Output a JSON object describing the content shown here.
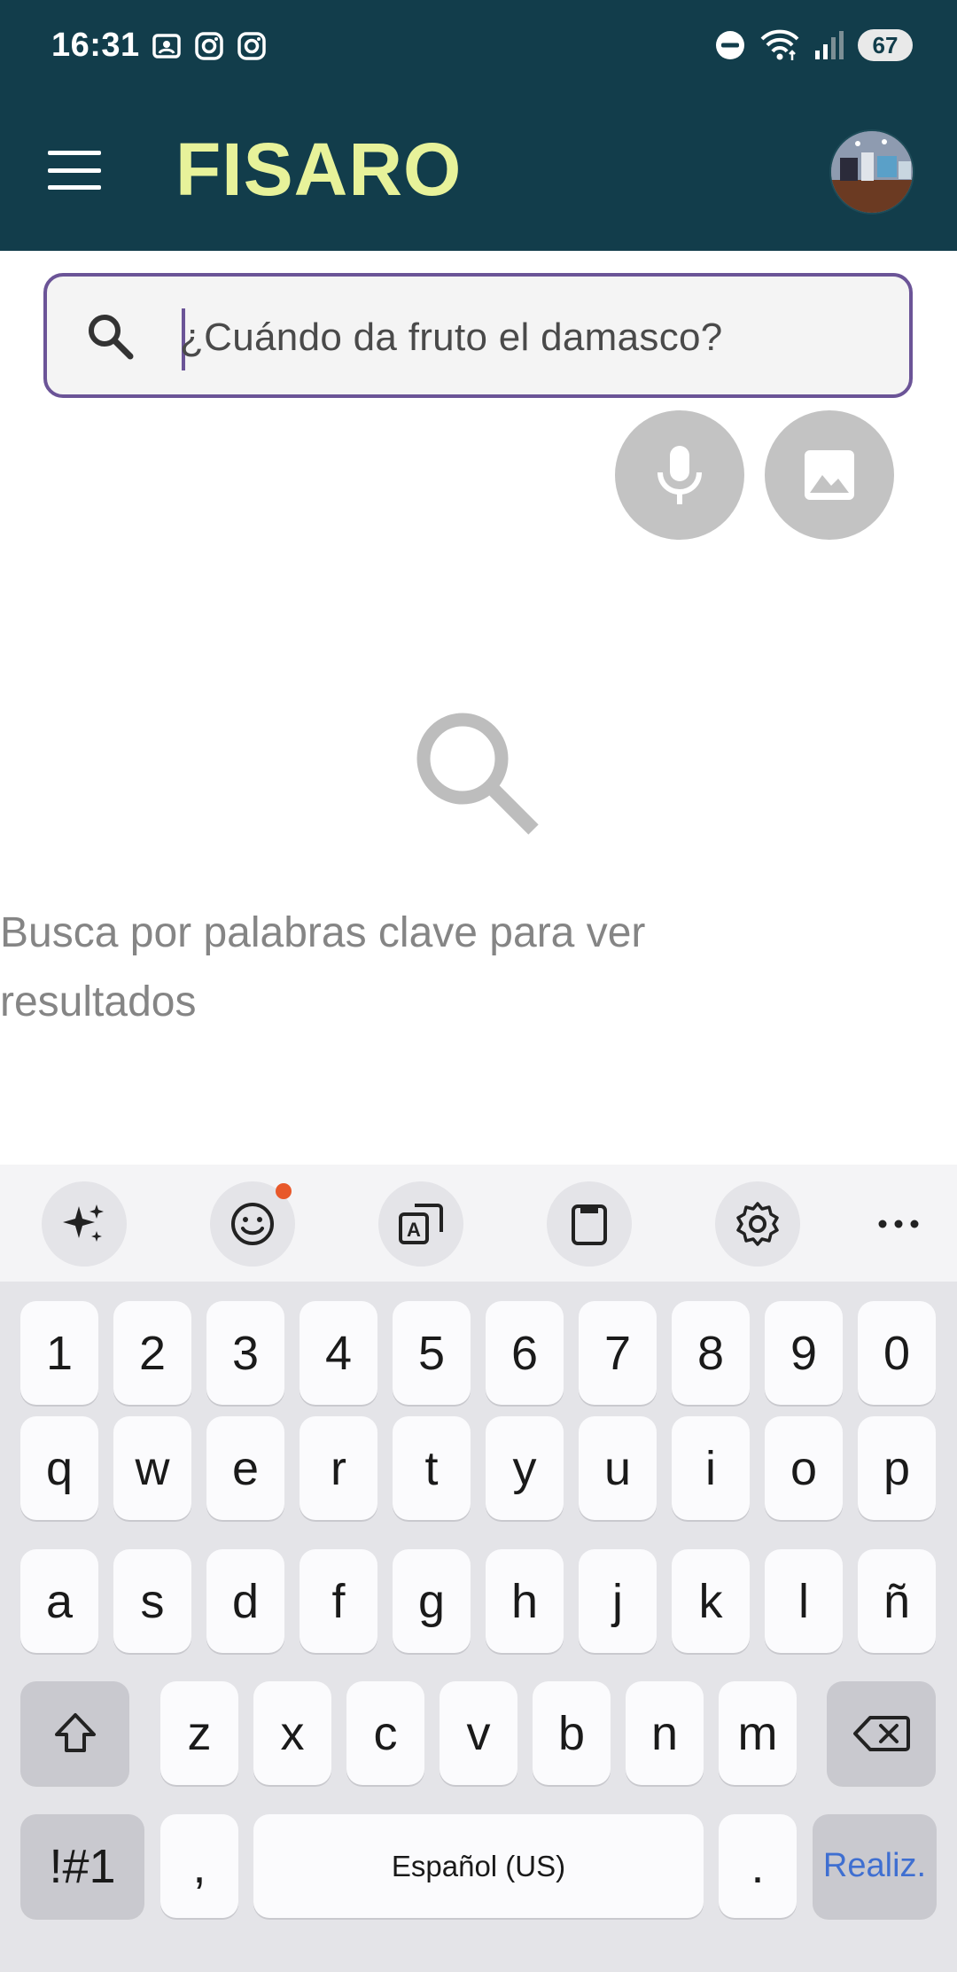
{
  "status_bar": {
    "time": "16:31",
    "battery": "67",
    "left_icons": [
      "screenshot-icon",
      "instagram-icon",
      "instagram-icon"
    ],
    "right_icons": [
      "do-not-disturb-icon",
      "wifi-icon",
      "signal-icon"
    ]
  },
  "header": {
    "brand": "FISARO",
    "brand_color": "#e7f29a",
    "background_color": "#123d4b"
  },
  "search": {
    "placeholder": "¿Cuándo da fruto el damasco?",
    "value": "",
    "border_color": "#6b5497"
  },
  "actions": {
    "voice_icon": "microphone-icon",
    "image_icon": "image-icon"
  },
  "empty_state": {
    "icon": "search-icon",
    "message": "Busca por palabras clave para ver resultados"
  },
  "keyboard": {
    "toolbar": [
      "sparkle-icon",
      "emoji-icon",
      "translate-icon",
      "clipboard-icon",
      "settings-icon",
      "more-icon"
    ],
    "row_numbers": [
      "1",
      "2",
      "3",
      "4",
      "5",
      "6",
      "7",
      "8",
      "9",
      "0"
    ],
    "row_1": [
      "q",
      "w",
      "e",
      "r",
      "t",
      "y",
      "u",
      "i",
      "o",
      "p"
    ],
    "row_2": [
      "a",
      "s",
      "d",
      "f",
      "g",
      "h",
      "j",
      "k",
      "l",
      "ñ"
    ],
    "row_3": [
      "z",
      "x",
      "c",
      "v",
      "b",
      "n",
      "m"
    ],
    "symbols_label": "!#1",
    "comma_label": ",",
    "space_label": "Español (US)",
    "period_label": ".",
    "done_label": "Realiz.",
    "done_color": "#3f6fd1"
  }
}
